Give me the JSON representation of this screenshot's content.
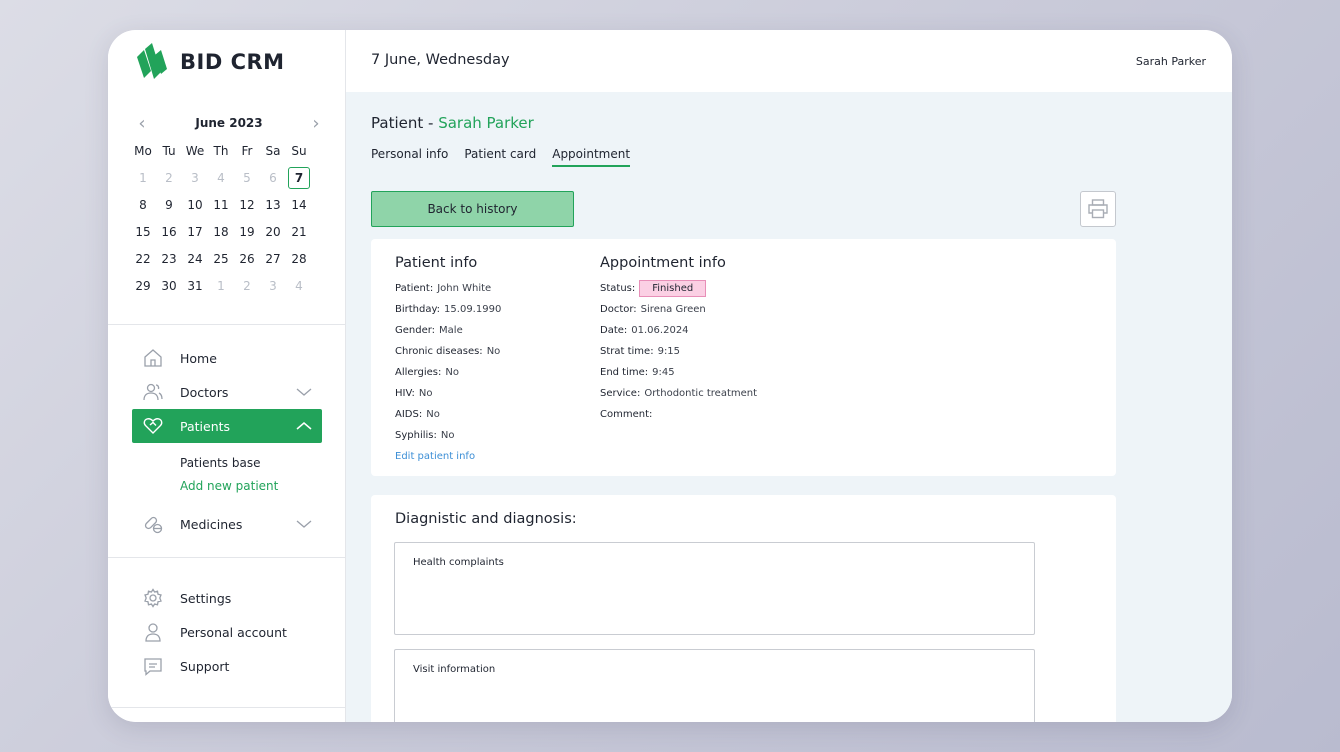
{
  "brand": {
    "name": "BID CRM",
    "logo_color": "#22a35a"
  },
  "header": {
    "date": "7 June, Wednesday",
    "user": "Sarah Parker"
  },
  "calendar": {
    "month_label": "June 2023",
    "weekdays": [
      "Mo",
      "Tu",
      "We",
      "Th",
      "Fr",
      "Sa",
      "Su"
    ],
    "weeks": [
      [
        {
          "d": "1",
          "m": true
        },
        {
          "d": "2",
          "m": true
        },
        {
          "d": "3",
          "m": true
        },
        {
          "d": "4",
          "m": true
        },
        {
          "d": "5",
          "m": true
        },
        {
          "d": "6",
          "m": true
        },
        {
          "d": "7",
          "t": true
        }
      ],
      [
        {
          "d": "8"
        },
        {
          "d": "9"
        },
        {
          "d": "10"
        },
        {
          "d": "11"
        },
        {
          "d": "12"
        },
        {
          "d": "13"
        },
        {
          "d": "14"
        }
      ],
      [
        {
          "d": "15"
        },
        {
          "d": "16"
        },
        {
          "d": "17"
        },
        {
          "d": "18"
        },
        {
          "d": "19"
        },
        {
          "d": "20"
        },
        {
          "d": "21"
        }
      ],
      [
        {
          "d": "22"
        },
        {
          "d": "23"
        },
        {
          "d": "24"
        },
        {
          "d": "25"
        },
        {
          "d": "26"
        },
        {
          "d": "27"
        },
        {
          "d": "28"
        }
      ],
      [
        {
          "d": "29"
        },
        {
          "d": "30"
        },
        {
          "d": "31"
        },
        {
          "d": "1",
          "m": true
        },
        {
          "d": "2",
          "m": true
        },
        {
          "d": "3",
          "m": true
        },
        {
          "d": "4",
          "m": true
        }
      ]
    ]
  },
  "nav": {
    "home": "Home",
    "doctors": "Doctors",
    "patients": "Patients",
    "patients_base": "Patients base",
    "add_new_patient": "Add new patient",
    "medicines": "Medicines",
    "settings": "Settings",
    "personal_account": "Personal account",
    "support": "Support"
  },
  "page": {
    "title_prefix": "Patient - ",
    "title_name": "Sarah Parker",
    "tabs": [
      "Personal info",
      "Patient card",
      "Appointment"
    ],
    "active_tab": "Appointment",
    "back_button": "Back to history"
  },
  "patient_info": {
    "title": "Patient info",
    "fields": [
      {
        "label": "Patient:",
        "value": "John White"
      },
      {
        "label": "Birthday:",
        "value": "15.09.1990"
      },
      {
        "label": "Gender:",
        "value": "Male"
      },
      {
        "label": "Chronic diseases:",
        "value": "No"
      },
      {
        "label": "Allergies:",
        "value": "No"
      },
      {
        "label": "HIV:",
        "value": "No"
      },
      {
        "label": "AIDS:",
        "value": "No"
      },
      {
        "label": "Syphilis:",
        "value": "No"
      }
    ],
    "edit_link": "Edit patient info"
  },
  "appointment_info": {
    "title": "Appointment info",
    "status_label": "Status:",
    "status": "Finished",
    "fields": [
      {
        "label": "Doctor:",
        "value": "Sirena Green"
      },
      {
        "label": "Date:",
        "value": "01.06.2024"
      },
      {
        "label": "Strat time:",
        "value": "9:15"
      },
      {
        "label": "End time:",
        "value": "9:45"
      },
      {
        "label": "Service:",
        "value": "Orthodontic treatment"
      },
      {
        "label": "Comment:",
        "value": ""
      }
    ]
  },
  "diagnosis": {
    "title": "Diagnistic and diagnosis:",
    "health_complaints": "Health complaints",
    "visit_information": "Visit information"
  }
}
